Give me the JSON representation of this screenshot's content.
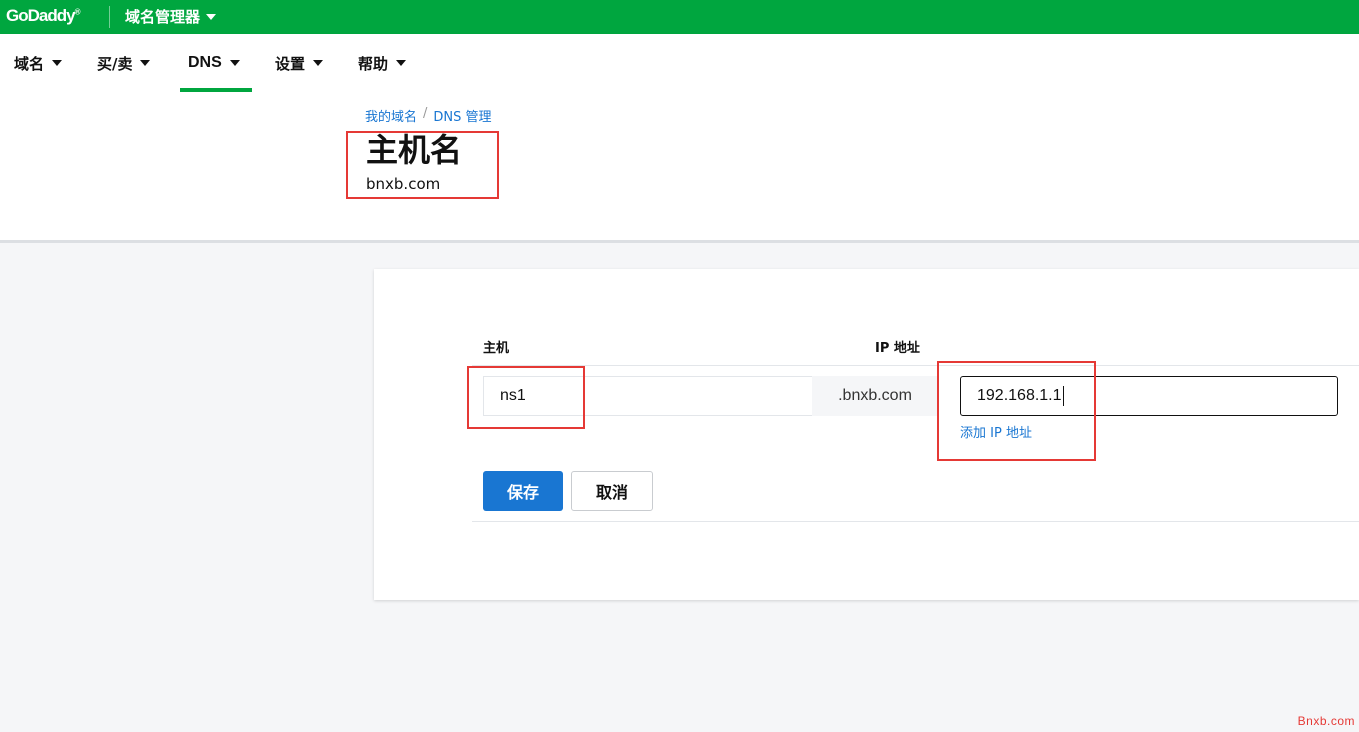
{
  "topbar": {
    "logo_text": "GoDaddy",
    "logo_mark": "®",
    "app_menu_label": "域名管理器",
    "brand_color": "#00a63f"
  },
  "nav": {
    "items": [
      {
        "label": "域名",
        "active": false
      },
      {
        "label": "买/卖",
        "active": false
      },
      {
        "label": "DNS",
        "active": true
      },
      {
        "label": "设置",
        "active": false
      },
      {
        "label": "帮助",
        "active": false
      }
    ]
  },
  "breadcrumb": {
    "items": [
      "我的域名",
      "DNS 管理"
    ],
    "separator": "/"
  },
  "page": {
    "title": "主机名",
    "subtitle": "bnxb.com"
  },
  "form": {
    "host_label": "主机",
    "ip_label": "IP 地址",
    "host_value": "ns1",
    "domain_suffix": ".bnxb.com",
    "ip_value": "192.168.1.1",
    "add_ip_link": "添加 IP 地址",
    "save_label": "保存",
    "cancel_label": "取消"
  },
  "colors": {
    "primary_button": "#1976d2",
    "highlight_box": "#e53935"
  },
  "watermark": "Bnxb.com"
}
